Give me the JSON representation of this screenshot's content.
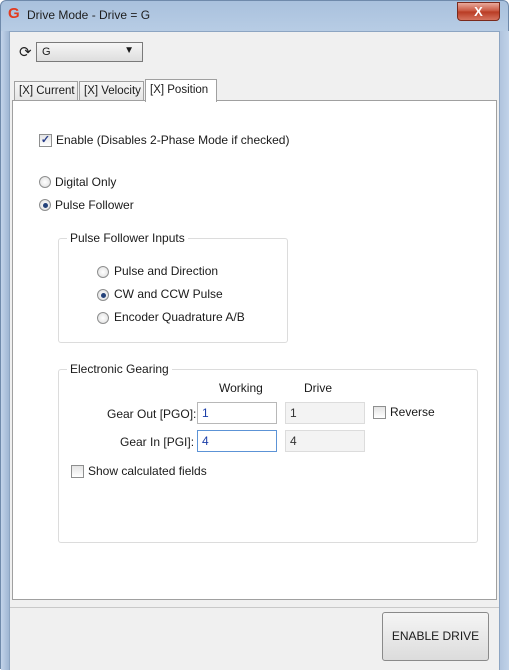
{
  "window": {
    "title": "Drive Mode - Drive = G",
    "app_icon": "G",
    "close_label": "X"
  },
  "drive_selector": {
    "value": "G"
  },
  "tabs": [
    {
      "label": "[X] Current",
      "active": false
    },
    {
      "label": "[X] Velocity",
      "active": false
    },
    {
      "label": "[X] Position",
      "active": true
    }
  ],
  "enable_checkbox": {
    "label": "Enable (Disables 2-Phase Mode if checked)",
    "checked": true
  },
  "mode_options": [
    {
      "label": "Digital Only",
      "selected": false
    },
    {
      "label": "Pulse Follower",
      "selected": true
    }
  ],
  "pulse_follower_inputs": {
    "title": "Pulse Follower Inputs",
    "options": [
      {
        "label": "Pulse and Direction",
        "selected": false
      },
      {
        "label": "CW and CCW Pulse",
        "selected": true
      },
      {
        "label": "Encoder Quadrature A/B",
        "selected": false
      }
    ]
  },
  "electronic_gearing": {
    "title": "Electronic Gearing",
    "col_working": "Working",
    "col_drive": "Drive",
    "gear_out": {
      "label": "Gear Out [PGO]:",
      "working": "1",
      "drive": "1"
    },
    "gear_in": {
      "label": "Gear In [PGI]:",
      "working": "4",
      "drive": "4"
    },
    "reverse": {
      "label": "Reverse",
      "checked": false
    },
    "show_calculated": {
      "label": "Show calculated fields",
      "checked": false
    }
  },
  "enable_drive_button": "ENABLE DRIVE",
  "colors": {
    "accent": "#24427a",
    "close": "#c7523b",
    "frame": "#bcd0e7"
  }
}
